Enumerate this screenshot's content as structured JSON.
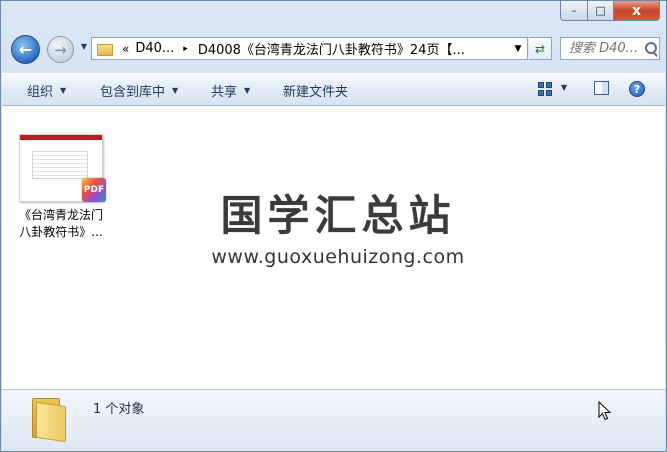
{
  "window": {
    "minimize_glyph": "–",
    "maximize_glyph": "□",
    "close_glyph": "x"
  },
  "nav": {
    "back_glyph": "←",
    "forward_glyph": "→",
    "recent_glyph": "▼"
  },
  "address": {
    "overflow": "«",
    "segment": "D40...",
    "separator": "▸",
    "current": "D4008《台湾青龙法门八卦教符书》24页【...",
    "dropdown_glyph": "▼",
    "refresh_glyph": "⇄"
  },
  "search": {
    "placeholder": "搜索 D40..."
  },
  "toolbar": {
    "organize": "组织",
    "include_in_library": "包含到库中",
    "share": "共享",
    "new_folder": "新建文件夹",
    "dropdown_glyph": "▼",
    "help_glyph": "?"
  },
  "files": [
    {
      "name_line1": "《台湾青龙法门",
      "name_line2": "八卦教符书》...",
      "badge": "PDF",
      "type": "pdf"
    }
  ],
  "watermark": {
    "title": "国学汇总站",
    "url": "www.guoxuehuizong.com"
  },
  "details": {
    "count": "1 个对象"
  }
}
